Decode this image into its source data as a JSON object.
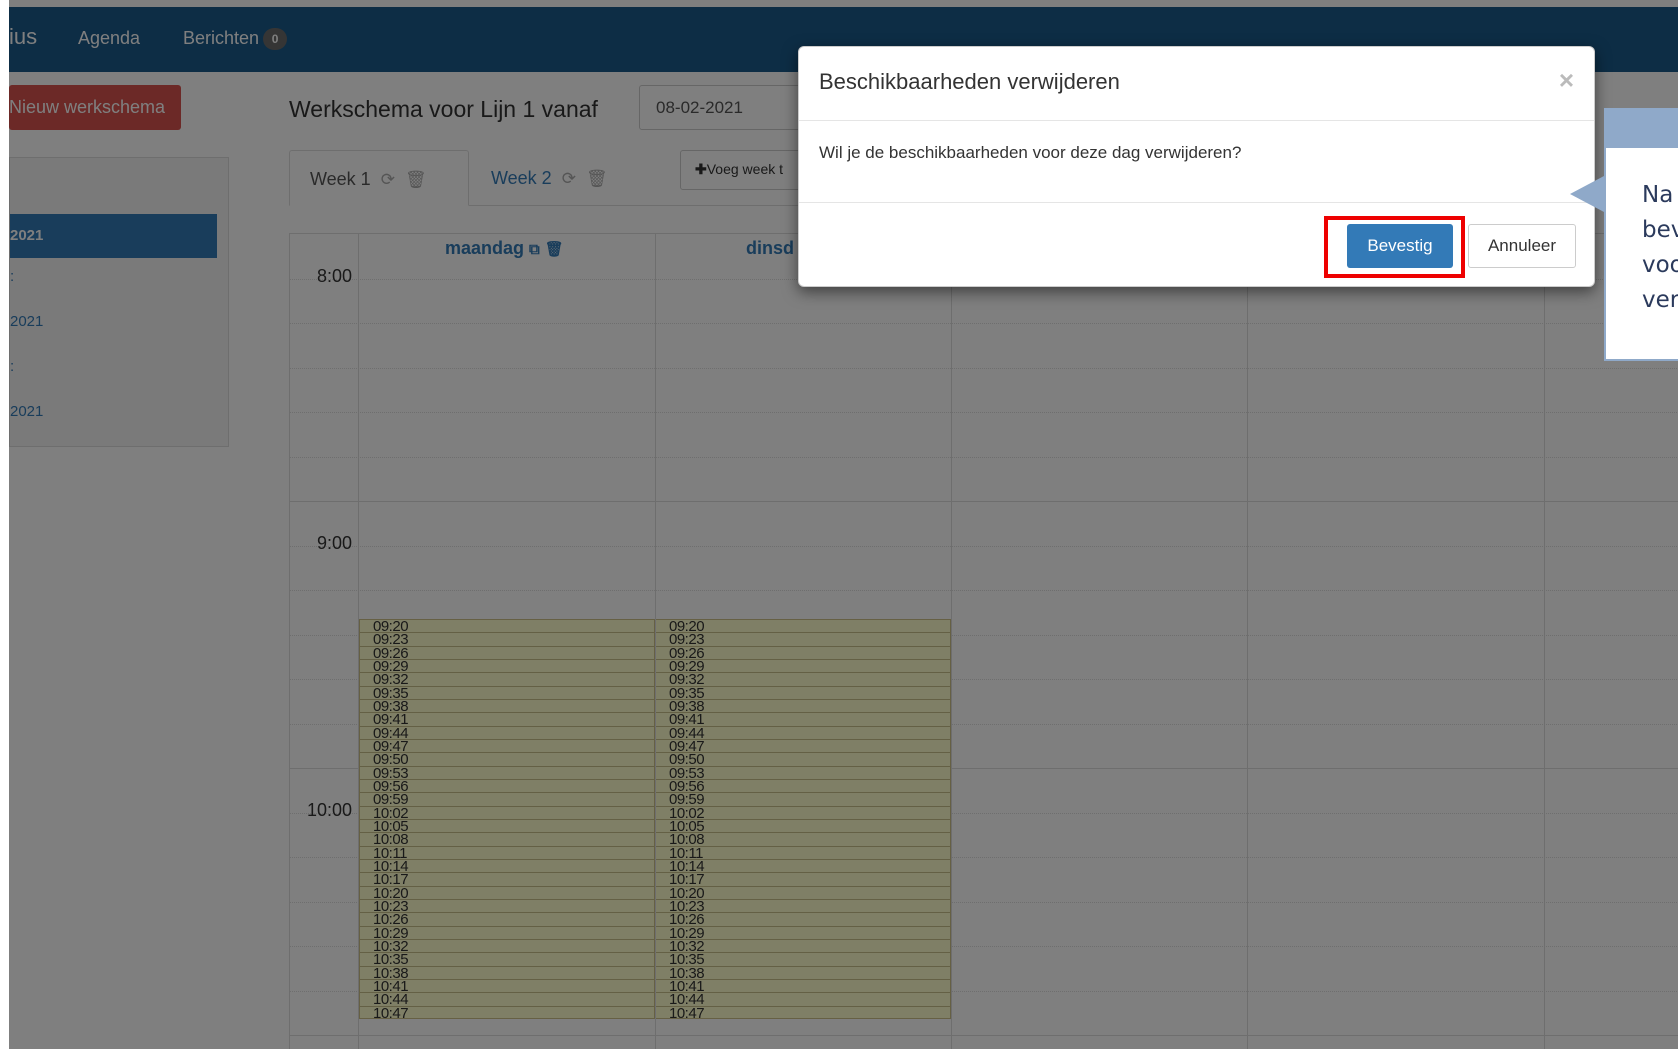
{
  "nav": {
    "brand": "ius",
    "agenda": "Agenda",
    "messages": "Berichten",
    "messages_count": "0"
  },
  "sidebar": {
    "new_button": "Nieuw werkschema",
    "items": [
      {
        "label": "2021"
      },
      {
        "label": ":"
      },
      {
        "label": "2021"
      },
      {
        "label": ":"
      },
      {
        "label": "2021"
      }
    ]
  },
  "main": {
    "title": "Werkschema voor Lijn 1 vanaf",
    "date_value": "08-02-2021",
    "tabs": [
      {
        "label": "Week 1"
      },
      {
        "label": "Week 2"
      }
    ],
    "add_week": "Voeg week t"
  },
  "calendar": {
    "days": [
      "maandag",
      "dinsd"
    ],
    "times": [
      "8:00",
      "9:00",
      "10:00"
    ],
    "slots": [
      "09:20",
      "09:23",
      "09:26",
      "09:29",
      "09:32",
      "09:35",
      "09:38",
      "09:41",
      "09:44",
      "09:47",
      "09:50",
      "09:53",
      "09:56",
      "09:59",
      "10:02",
      "10:05",
      "10:08",
      "10:11",
      "10:14",
      "10:17",
      "10:20",
      "10:23",
      "10:26",
      "10:29",
      "10:32",
      "10:35",
      "10:38",
      "10:41",
      "10:44",
      "10:47"
    ]
  },
  "modal": {
    "title": "Beschikbaarheden verwijderen",
    "close": "×",
    "body": "Wil je de beschikbaarheden voor deze dag verwijderen?",
    "confirm": "Bevestig",
    "cancel": "Annuleer"
  },
  "callout": {
    "lines": [
      "Na",
      "bev",
      "voo",
      "ver"
    ]
  },
  "colors": {
    "nav": "#1b5a8a",
    "primary": "#337ab7",
    "danger": "#d9534f",
    "slot_bg": "#ffffcc",
    "highlight": "#ee0000",
    "callout": "#8fa9c9"
  }
}
